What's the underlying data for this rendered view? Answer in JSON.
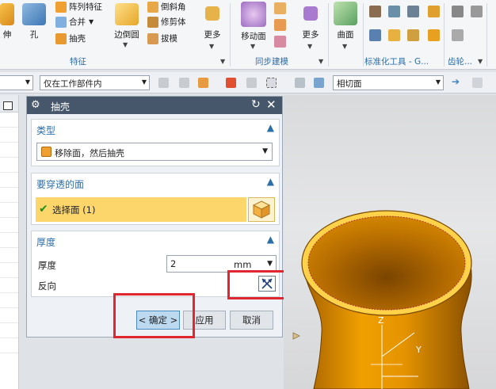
{
  "ribbon": {
    "tools": {
      "stretch": "伸",
      "hole": "孔",
      "pattern_feature": "阵列特征",
      "combine": "合并",
      "shell": "抽壳",
      "edge_blend": "边倒圆",
      "chamfer": "倒斜角",
      "trim_body": "修剪体",
      "draft": "拔模",
      "more1": "更多",
      "move_face": "移动面",
      "more2": "更多",
      "surface": "曲面"
    },
    "groups": {
      "feature": "特征",
      "sync_modeling": "同步建模",
      "standard_parts": "标准化工具 - G...",
      "gear": "齿轮..."
    }
  },
  "filterbar": {
    "scope": "仅在工作部件内",
    "face_rule": "相切面"
  },
  "dialog": {
    "title": "抽壳",
    "type": {
      "header": "类型",
      "value": "移除面，然后抽壳"
    },
    "faces": {
      "header": "要穿透的面",
      "select_label": "选择面 (1)"
    },
    "thickness": {
      "header": "厚度",
      "label": "厚度",
      "value": "2",
      "unit": "mm",
      "reverse_label": "反向"
    },
    "buttons": {
      "ok": "< 确定 >",
      "apply": "应用",
      "cancel": "取消"
    }
  },
  "viewport": {
    "axis_z": "Z",
    "axis_y": "Y"
  },
  "colors": {
    "accent": "#2b6ea8",
    "selection": "#fcd66a",
    "highlight_box": "#e0262f",
    "part": "#f0a000"
  }
}
